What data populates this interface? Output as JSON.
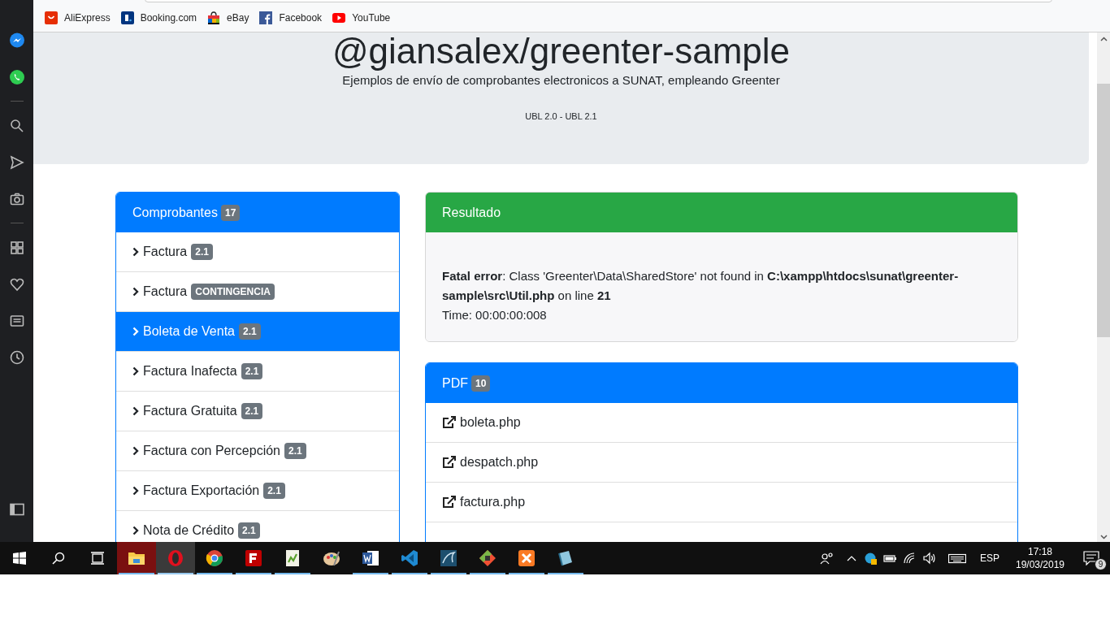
{
  "bookmarks": [
    {
      "label": "AliExpress",
      "kind": "aliexpress"
    },
    {
      "label": "Booking.com",
      "kind": "booking"
    },
    {
      "label": "eBay",
      "kind": "bag"
    },
    {
      "label": "Facebook",
      "kind": "facebook"
    },
    {
      "label": "YouTube",
      "kind": "youtube"
    }
  ],
  "header": {
    "title": "@giansalex/greenter-sample",
    "subtitle": "Ejemplos de envío de comprobantes electronicos a SUNAT, empleando Greenter",
    "versions": "UBL 2.0 - UBL 2.1"
  },
  "comprobantes": {
    "title": "Comprobantes",
    "count": "17",
    "items": [
      {
        "label": "Factura",
        "badge": "2.1",
        "selected": false
      },
      {
        "label": "Factura",
        "badge": "CONTINGENCIA",
        "selected": false
      },
      {
        "label": "Boleta de Venta",
        "badge": "2.1",
        "selected": true
      },
      {
        "label": "Factura Inafecta",
        "badge": "2.1",
        "selected": false
      },
      {
        "label": "Factura Gratuita",
        "badge": "2.1",
        "selected": false
      },
      {
        "label": "Factura con Percepción",
        "badge": "2.1",
        "selected": false
      },
      {
        "label": "Factura Exportación",
        "badge": "2.1",
        "selected": false
      },
      {
        "label": "Nota de Crédito",
        "badge": "2.1",
        "selected": false
      }
    ]
  },
  "resultado": {
    "title": "Resultado",
    "message": "**Fatal error**: Class 'Greenter\\Data\\SharedStore' not found in **C:\\xampp\\htdocs\\sunat\\greenter-sample\\src\\Util.php** on line **21**",
    "time": "Time: 00:00:00:008"
  },
  "pdf": {
    "title": "PDF",
    "count": "10",
    "items": [
      "boleta.php",
      "despatch.php",
      "factura.php"
    ]
  },
  "taskbar": {
    "apps": [
      {
        "kind": "folder",
        "running": true,
        "selected": false
      },
      {
        "kind": "opera",
        "running": true,
        "selected": true
      },
      {
        "kind": "chrome",
        "running": true,
        "selected": false
      },
      {
        "kind": "filezilla",
        "running": true,
        "selected": false
      },
      {
        "kind": "notepad",
        "running": true,
        "selected": false
      },
      {
        "kind": "palette",
        "running": false,
        "selected": false
      },
      {
        "kind": "word",
        "running": true,
        "selected": false
      },
      {
        "kind": "vscode",
        "running": true,
        "selected": false
      },
      {
        "kind": "dolphin",
        "running": true,
        "selected": false
      },
      {
        "kind": "git",
        "running": true,
        "selected": false
      },
      {
        "kind": "xampp",
        "running": true,
        "selected": false
      },
      {
        "kind": "book",
        "running": true,
        "selected": false
      }
    ],
    "language": "ESP",
    "time": "17:18",
    "date": "19/03/2019",
    "notifications": "9"
  }
}
